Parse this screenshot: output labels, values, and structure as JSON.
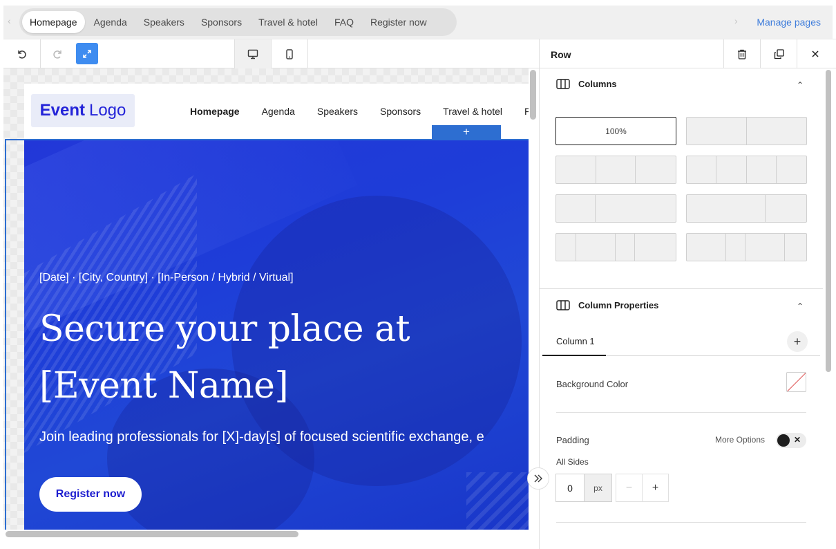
{
  "page_tabs": {
    "items": [
      {
        "label": "Homepage"
      },
      {
        "label": "Agenda"
      },
      {
        "label": "Speakers"
      },
      {
        "label": "Sponsors"
      },
      {
        "label": "Travel & hotel"
      },
      {
        "label": "FAQ"
      },
      {
        "label": "Register now"
      }
    ],
    "active_index": 0,
    "prev_icon": "chevron-left-icon",
    "next_icon": "chevron-right-icon",
    "manage_label": "Manage pages"
  },
  "toolbar": {
    "undo_icon": "undo-icon",
    "redo_icon": "redo-icon",
    "expand_icon": "expand-icon",
    "desktop_icon": "desktop-icon",
    "mobile_icon": "mobile-icon",
    "selected_device": "desktop",
    "accent": "#3e8cf0"
  },
  "site": {
    "logo_bold": "Event",
    "logo_rest": "Logo",
    "nav": [
      "Homepage",
      "Agenda",
      "Speakers",
      "Sponsors",
      "Travel & hotel",
      "F"
    ],
    "add_row_label": "+",
    "hero": {
      "meta": "[Date] · [City, Country] · [In-Person / Hybrid / Virtual]",
      "title_line1": "Secure your place at",
      "title_line2": "[Event Name]",
      "subtitle": "Join leading professionals for [X]-day[s] of focused scientific exchange, e",
      "cta": "Register now",
      "bg_color": "#2237d8"
    }
  },
  "panel": {
    "title": "Row",
    "delete_icon": "trash-icon",
    "duplicate_icon": "duplicate-icon",
    "close_icon": "close-icon",
    "collapse_icon": "double-chevron-right-icon",
    "columns_section": {
      "title": "Columns",
      "icon": "columns-icon",
      "selected_label": "100%"
    },
    "column_properties": {
      "title": "Column Properties",
      "icon": "columns-icon",
      "tab_label": "Column 1",
      "add_icon": "plus-icon",
      "background_color_label": "Background Color",
      "padding_label": "Padding",
      "more_options_label": "More Options",
      "more_options_on": true,
      "all_sides_label": "All Sides",
      "padding_value": "0",
      "padding_unit": "px",
      "decrement_label": "−",
      "increment_label": "+"
    }
  }
}
